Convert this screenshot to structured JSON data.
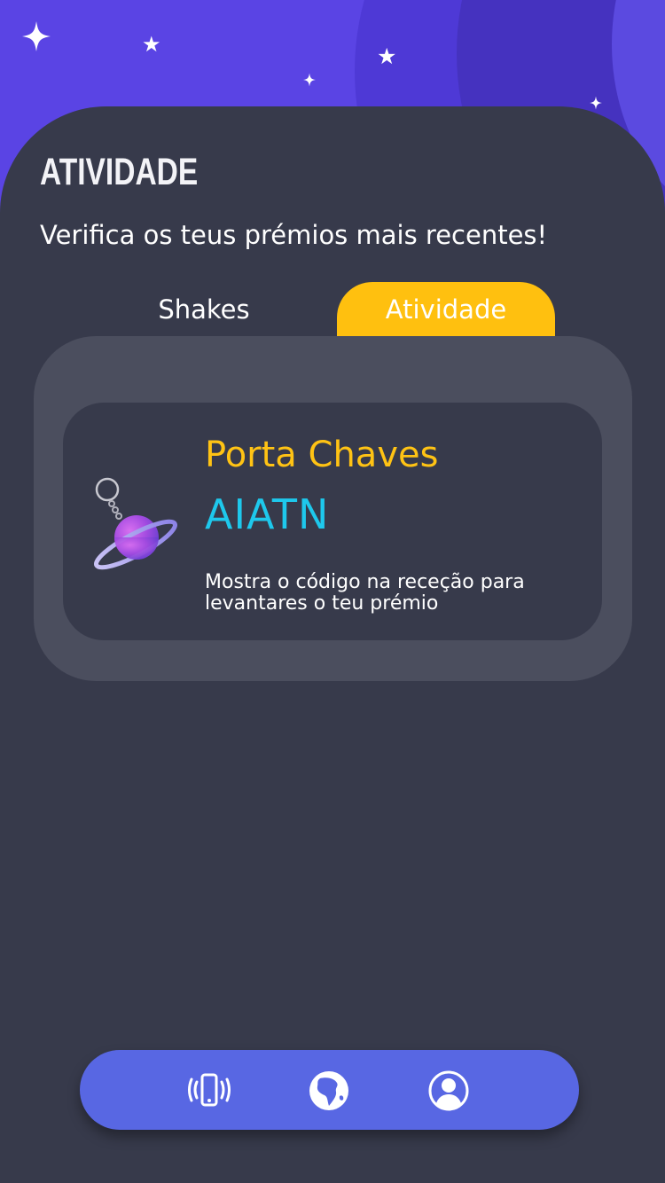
{
  "header": {
    "title": "ATIVIDADE",
    "subtitle": "Verifica os teus prémios mais recentes!"
  },
  "tabs": [
    {
      "label": "Shakes",
      "active": false
    },
    {
      "label": "Atividade",
      "active": true
    }
  ],
  "prize": {
    "name": "Porta Chaves",
    "code": "AIATN",
    "instructions": "Mostra o código na receção para levantares o teu prémio",
    "icon": "planet-keychain-icon"
  },
  "nav": {
    "items": [
      {
        "icon": "phone-shake-icon"
      },
      {
        "icon": "globe-icon"
      },
      {
        "icon": "profile-icon"
      }
    ]
  },
  "colors": {
    "background": "#373a4b",
    "hero": "#5a44e4",
    "accent_yellow": "#ffc00f",
    "code_cyan": "#1ec8ec",
    "navbar": "#5867e3"
  }
}
